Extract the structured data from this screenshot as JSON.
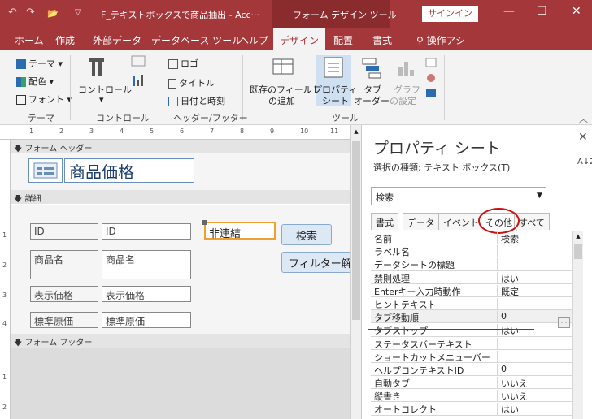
{
  "titlebar": {
    "undo": "↶",
    "redo": "↷",
    "open": "📂",
    "customize": "▽",
    "doc_title": "F_テキストボックスで商品抽出 - Acc···",
    "context_title": "フォーム デザイン ツール",
    "signin": "サインイン",
    "min": "—",
    "max": "☐",
    "close": "✕"
  },
  "tabs": [
    "ホーム",
    "作成",
    "外部データ",
    "データベース ツール",
    "ヘルプ",
    "デザイン",
    "配置",
    "書式",
    "操作アシ"
  ],
  "ribbon": {
    "theme": "テーマ",
    "color": "配色",
    "font": "フォント",
    "controls": "コントロール",
    "logo": "ロゴ",
    "title": "タイトル",
    "datetime": "日付と時刻",
    "addfield_1": "既存のフィールド",
    "addfield_2": "の追加",
    "prop_1": "プロパティ",
    "prop_2": "シート",
    "taborder_1": "タブ",
    "taborder_2": "オーダー",
    "chart_1": "グラフ",
    "chart_2": "の設定",
    "groups": [
      "テーマ",
      "コントロール",
      "ヘッダー/フッター",
      "ツール"
    ]
  },
  "ruler_marks": [
    "1",
    "2",
    "3",
    "4",
    "5",
    "6",
    "7",
    "8",
    "9",
    "10",
    "11"
  ],
  "vruler_marks": [
    "1",
    "2",
    "3",
    "4",
    "1",
    "2"
  ],
  "form": {
    "header_label": "フォーム ヘッダー",
    "form_title": "商品価格",
    "detail_label": "詳細",
    "footer_label": "フォーム フッター",
    "id_label": "ID",
    "id_field": "ID",
    "name_label": "商品名",
    "name_field": "商品名",
    "price_label": "表示価格",
    "price_field": "表示価格",
    "cost_label": "標準原価",
    "cost_field": "標準原価",
    "search_box": "非連結",
    "search_button": "検索",
    "filter_button": "フィルター解"
  },
  "property_sheet": {
    "title": "プロパティ シート",
    "selection_type": "選択の種類: テキスト ボックス(T)",
    "selected_object": "検索",
    "tabs": [
      "書式",
      "データ",
      "イベント",
      "その他",
      "すべて"
    ],
    "active_tab": "その他",
    "rows": [
      {
        "k": "名前",
        "v": "検索"
      },
      {
        "k": "ラベル名",
        "v": ""
      },
      {
        "k": "データシートの標題",
        "v": ""
      },
      {
        "k": "禁則処理",
        "v": "はい"
      },
      {
        "k": "Enterキー入力時動作",
        "v": "既定"
      },
      {
        "k": "ヒントテキスト",
        "v": ""
      },
      {
        "k": "タブ移動順",
        "v": "0"
      },
      {
        "k": "タブストップ",
        "v": "はい"
      },
      {
        "k": "ステータスバーテキスト",
        "v": ""
      },
      {
        "k": "ショートカットメニューバー",
        "v": ""
      },
      {
        "k": "ヘルプコンテキストID",
        "v": "0"
      },
      {
        "k": "自動タブ",
        "v": "いいえ"
      },
      {
        "k": "縦書き",
        "v": "いいえ"
      },
      {
        "k": "オートコレクト",
        "v": "はい"
      }
    ],
    "ellipsis": "···",
    "close": "✕",
    "sort": "A↓Z"
  },
  "colors": {
    "brand": "#a4373a",
    "annotation": "#d01010",
    "selection": "#f0a030"
  }
}
